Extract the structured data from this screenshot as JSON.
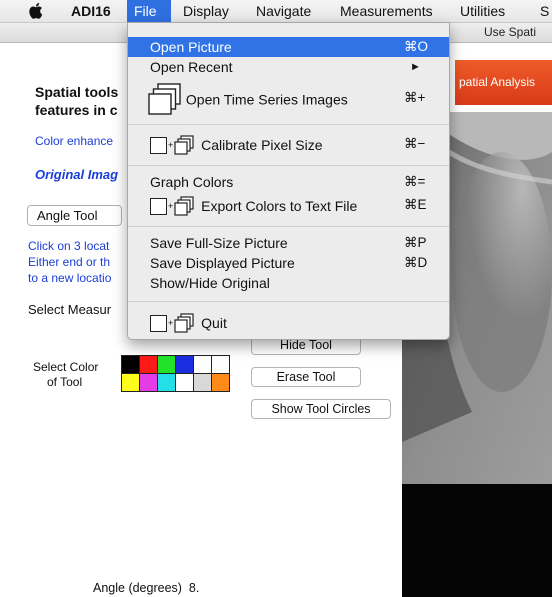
{
  "menubar": {
    "apple": "",
    "app": "ADI16",
    "items": [
      "File",
      "Display",
      "Navigate",
      "Measurements",
      "Utilities",
      "S"
    ]
  },
  "toolbar": {
    "use_text": "Use Spati"
  },
  "left": {
    "heading_line1": "Spatial tools",
    "heading_line2": "features in c",
    "color_enhance": "Color enhance",
    "original_image": "Original Imag",
    "tool_select": "Angle Tool",
    "instructions": [
      "Click on 3 locat",
      "Either end or th",
      "to a new locatio"
    ],
    "select_measure": "Select Measur",
    "select_color_line1": "Select Color",
    "select_color_line2": "of Tool",
    "swatches": [
      "#000000",
      "#ff1a1a",
      "#22e32a",
      "#1a2ee0",
      "#ffffff",
      "#ffffff",
      "#ffff1a",
      "#e63ce6",
      "#22e0e6",
      "#ffffff",
      "#d8d8d8",
      "#ff8a1a"
    ],
    "hide_tool": "Hide Tool",
    "erase_tool": "Erase Tool",
    "show_circles": "Show Tool Circles",
    "angle_label": "Angle (degrees)",
    "angle_value": "8."
  },
  "right": {
    "banner": "patial Analysis"
  },
  "file_menu": {
    "open_picture": "Open Picture",
    "open_picture_sc": "⌘O",
    "open_recent": "Open Recent",
    "open_recent_arrow": "►",
    "open_time_series": "Open Time Series Images",
    "open_time_series_sc": "⌘+",
    "calibrate": "Calibrate Pixel Size",
    "calibrate_sc": "⌘−",
    "graph_colors": "Graph Colors",
    "graph_colors_sc": "⌘=",
    "export_colors": "Export Colors to Text File",
    "export_colors_sc": "⌘E",
    "save_full": "Save Full-Size Picture",
    "save_full_sc": "⌘P",
    "save_displayed": "Save Displayed Picture",
    "save_displayed_sc": "⌘D",
    "show_hide": "Show/Hide Original",
    "quit": "Quit"
  }
}
